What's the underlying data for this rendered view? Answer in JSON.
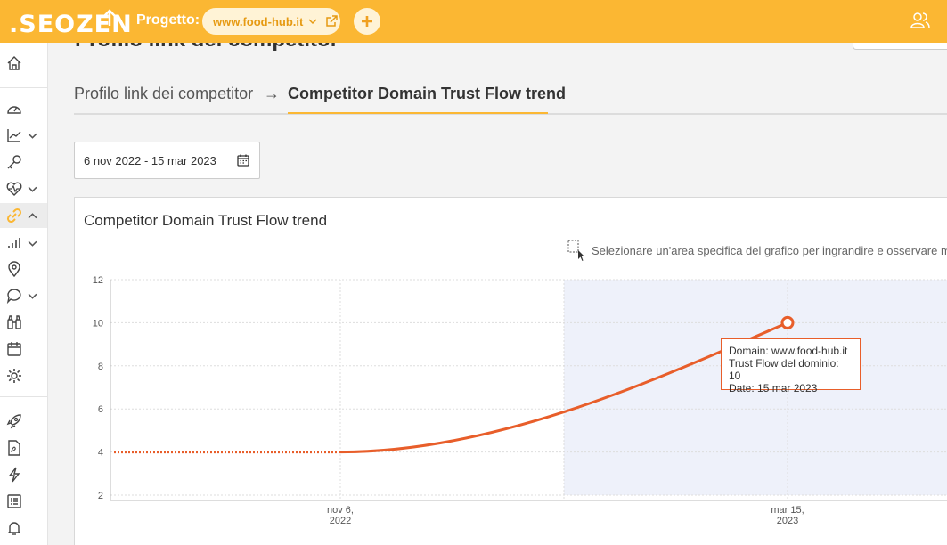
{
  "header": {
    "logo_text": ".SEOZEN",
    "project_label": "Progetto:",
    "project_name": "www.food-hub.it"
  },
  "sidebar": {
    "items": [
      {
        "icon": "home-icon"
      },
      {
        "icon": "dashboard-icon"
      },
      {
        "icon": "trend-icon"
      },
      {
        "icon": "key-icon"
      },
      {
        "icon": "heartbeat-icon"
      },
      {
        "icon": "link-icon",
        "active": true
      },
      {
        "icon": "bar-chart-icon"
      },
      {
        "icon": "location-pin-icon"
      },
      {
        "icon": "chat-icon"
      },
      {
        "icon": "binoculars-icon"
      },
      {
        "icon": "calendar-icon"
      },
      {
        "icon": "gear-icon"
      },
      {
        "icon": "rocket-icon"
      },
      {
        "icon": "pdf-icon"
      },
      {
        "icon": "lightning-icon"
      },
      {
        "icon": "checklist-icon"
      },
      {
        "icon": "bell-icon"
      }
    ]
  },
  "page": {
    "cut_title": "Profilo link dei competitor",
    "breadcrumb_parent": "Profilo link dei competitor",
    "breadcrumb_arrow": "→",
    "breadcrumb_current": "Competitor Domain Trust Flow trend"
  },
  "date_range": {
    "value": "6 nov 2022 - 15 mar 2023"
  },
  "card": {
    "title": "Competitor Domain Trust Flow trend",
    "zoom_hint": "Selezionare un'area specifica del grafico per ingrandire e osservare ma"
  },
  "tooltip": {
    "line1": "Domain: www.food-hub.it",
    "line2": "Trust Flow del dominio: 10",
    "line3": "Date: 15 mar 2023"
  },
  "colors": {
    "accent": "#fbb733",
    "series": "#e85e2a",
    "highlight": "#eef1fa"
  },
  "chart_data": {
    "type": "line",
    "title": "",
    "xlabel": "",
    "ylabel": "",
    "ylim": [
      2,
      12
    ],
    "y_ticks": [
      "2",
      "4",
      "6",
      "8",
      "10",
      "12"
    ],
    "x_ticks": [
      {
        "line1": "nov 6,",
        "line2": "2022"
      },
      {
        "line1": "mar 15,",
        "line2": "2023"
      }
    ],
    "series": [
      {
        "name": "",
        "x": [
          "2022-11-06",
          "2023-03-15"
        ],
        "y": [
          4,
          10
        ]
      }
    ],
    "grid": true
  }
}
